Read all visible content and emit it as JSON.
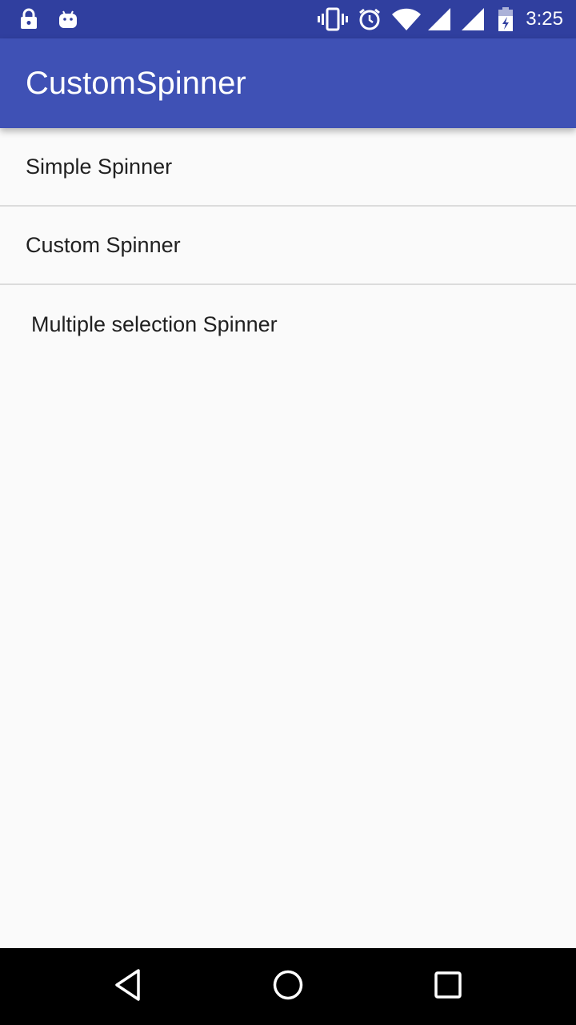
{
  "status_bar": {
    "time": "3:25",
    "icons": [
      "lock-icon",
      "android-icon",
      "vibrate-icon",
      "alarm-icon",
      "wifi-icon",
      "signal-icon",
      "signal-icon",
      "battery-charging-icon"
    ],
    "background": "#303f9f"
  },
  "app_bar": {
    "title": "CustomSpinner",
    "background": "#3f51b5"
  },
  "list": {
    "items": [
      {
        "label": "Simple Spinner"
      },
      {
        "label": "Custom Spinner"
      },
      {
        "label": "Multiple selection Spinner"
      }
    ]
  },
  "nav_bar": {
    "buttons": [
      "back-icon",
      "home-icon",
      "recents-icon"
    ]
  }
}
